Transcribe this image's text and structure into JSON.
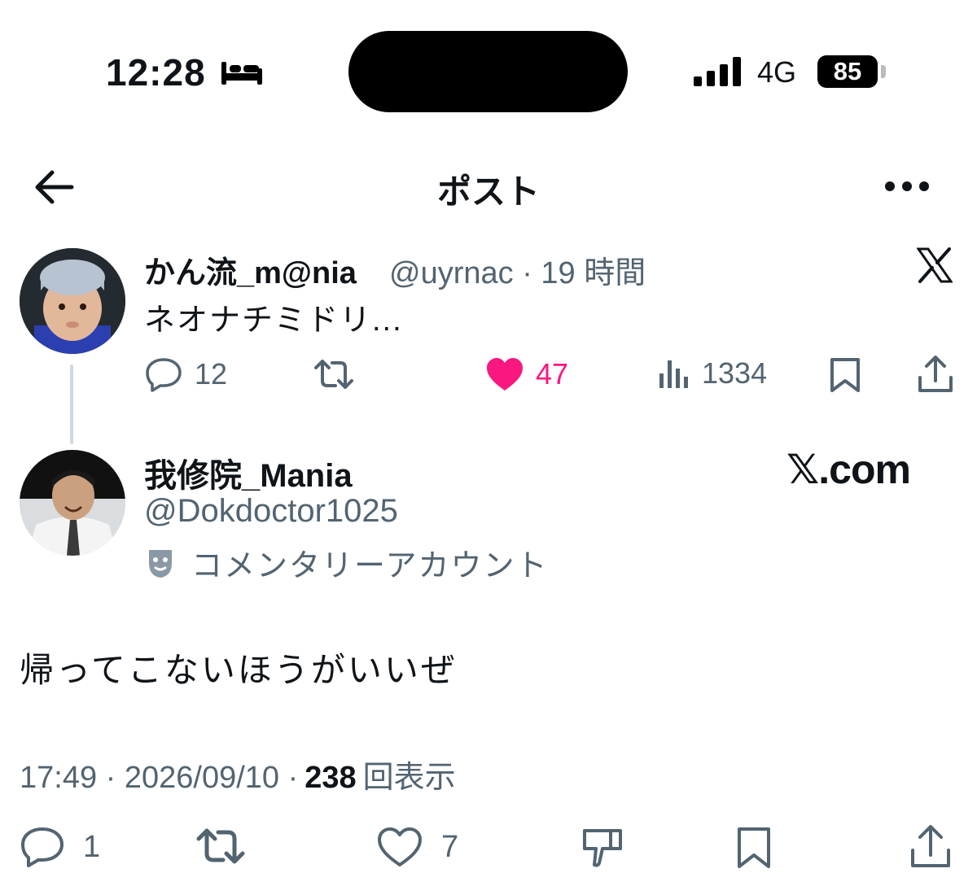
{
  "status_bar": {
    "time": "12:28",
    "network": "4G",
    "battery": "85"
  },
  "header": {
    "title": "ポスト"
  },
  "quoted_tweet": {
    "name": "かん流_m@nia",
    "handle_time": "@uyrnac · 19 時間",
    "text": "ネオナチミドリ...",
    "reply_count": "12",
    "like_count": "47",
    "view_count": "1334"
  },
  "main_tweet": {
    "name": "我修院_Mania",
    "handle": "@Dokdoctor1025",
    "account_label": "コメンタリーアカウント",
    "brand": "𝕏.com",
    "text": "帰ってこないほうがいいぜ",
    "meta_time": "17:49 · 2026/09/10 ·",
    "meta_views": "238",
    "meta_views_label": "回表示"
  },
  "action_bar": {
    "reply_count": "1",
    "like_count": "7"
  },
  "colors": {
    "text": "#0f1419",
    "secondary": "#536471",
    "like": "#f91880",
    "thread_line": "#cfd9de"
  }
}
